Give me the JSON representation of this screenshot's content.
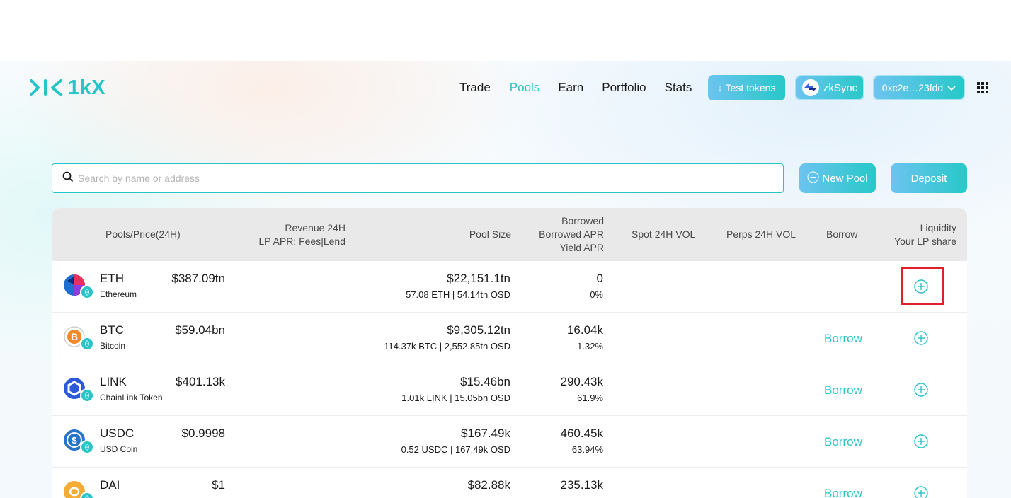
{
  "app": {
    "logo_text": "1kX"
  },
  "nav": {
    "items": [
      "Trade",
      "Pools",
      "Earn",
      "Portfolio",
      "Stats"
    ],
    "active": "Pools"
  },
  "header": {
    "test_tokens_label": "Test tokens",
    "network_label": "zkSync",
    "wallet_label": "0xc2e…23fdd"
  },
  "search": {
    "placeholder": "Search by name or address",
    "value": ""
  },
  "actions": {
    "new_pool_label": "New Pool",
    "deposit_label": "Deposit"
  },
  "table": {
    "headers": {
      "pools": "Pools/Price(24H)",
      "revenue_1": "Revenue 24H",
      "revenue_2": "LP APR: Fees|Lend",
      "pool_size": "Pool Size",
      "borrowed_1": "Borrowed",
      "borrowed_2": "Borrowed APR",
      "borrowed_3": "Yield APR",
      "spot_vol": "Spot 24H VOL",
      "perps_vol": "Perps 24H VOL",
      "borrow": "Borrow",
      "liquidity_1": "Liquidity",
      "liquidity_2": "Your LP share"
    },
    "rows": [
      {
        "symbol": "ETH",
        "name": "Ethereum",
        "price": "$387.09tn",
        "pool_size": "$22,151.1tn",
        "pool_detail": "57.08 ETH | 54.14tn OSD",
        "borrowed": "0",
        "apr": "0%",
        "borrow_label": "",
        "icon": "eth-icon",
        "color": "#1f6fd0"
      },
      {
        "symbol": "BTC",
        "name": "Bitcoin",
        "price": "$59.04bn",
        "pool_size": "$9,305.12tn",
        "pool_detail": "114.37k BTC | 2,552.85tn OSD",
        "borrowed": "16.04k",
        "apr": "1.32%",
        "borrow_label": "Borrow",
        "icon": "btc-icon",
        "color": "#f08a2a"
      },
      {
        "symbol": "LINK",
        "name": "ChainLink Token",
        "price": "$401.13k",
        "pool_size": "$15.46bn",
        "pool_detail": "1.01k LINK | 15.05bn OSD",
        "borrowed": "290.43k",
        "apr": "61.9%",
        "borrow_label": "Borrow",
        "icon": "link-icon",
        "color": "#2a5ada"
      },
      {
        "symbol": "USDC",
        "name": "USD Coin",
        "price": "$0.9998",
        "pool_size": "$167.49k",
        "pool_detail": "0.52 USDC | 167.49k OSD",
        "borrowed": "460.45k",
        "apr": "63.94%",
        "borrow_label": "Borrow",
        "icon": "usdc-icon",
        "color": "#2775ca"
      },
      {
        "symbol": "DAI",
        "name": "",
        "price": "$1",
        "pool_size": "$82.88k",
        "pool_detail": "",
        "borrowed": "235.13k",
        "apr": "",
        "borrow_label": "Borrow",
        "icon": "dai-icon",
        "color": "#f5ac37"
      }
    ]
  },
  "colors": {
    "accent": "#27c4c8",
    "highlight": "#e0202a"
  }
}
